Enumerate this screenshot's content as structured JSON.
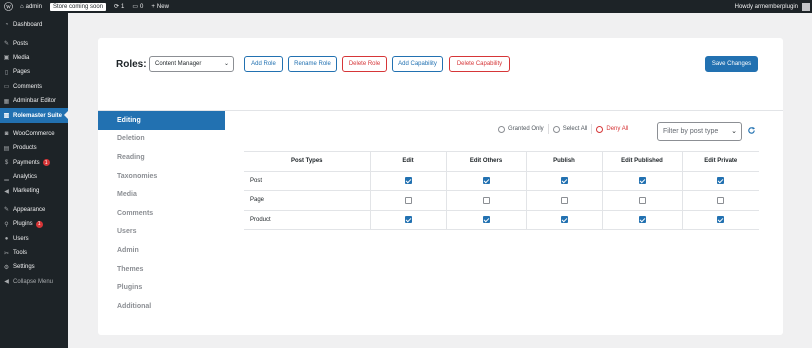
{
  "adminbar": {
    "site_name": "admin",
    "coming_soon": "Store coming soon",
    "updates_count": "1",
    "comments_count": "0",
    "new_label": "New",
    "howdy": "Howdy armemberplugin"
  },
  "sidebar": {
    "items": [
      {
        "label": "Dashboard",
        "icon": "dashboard-icon"
      },
      {
        "label": "Posts",
        "icon": "pin-icon"
      },
      {
        "label": "Media",
        "icon": "media-icon"
      },
      {
        "label": "Pages",
        "icon": "page-icon"
      },
      {
        "label": "Comments",
        "icon": "comment-icon"
      },
      {
        "label": "Adminbar Editor",
        "icon": "grid-icon"
      },
      {
        "label": "Rolemaster Suite",
        "icon": "building-icon"
      },
      {
        "label": "WooCommerce",
        "icon": "woo-icon"
      },
      {
        "label": "Products",
        "icon": "box-icon"
      },
      {
        "label": "Payments",
        "icon": "card-icon",
        "badge": "1"
      },
      {
        "label": "Analytics",
        "icon": "chart-icon"
      },
      {
        "label": "Marketing",
        "icon": "megaphone-icon"
      },
      {
        "label": "Appearance",
        "icon": "brush-icon"
      },
      {
        "label": "Plugins",
        "icon": "plug-icon",
        "badge": "1"
      },
      {
        "label": "Users",
        "icon": "user-icon"
      },
      {
        "label": "Tools",
        "icon": "wrench-icon"
      },
      {
        "label": "Settings",
        "icon": "settings-icon"
      },
      {
        "label": "Collapse Menu",
        "icon": "collapse-icon"
      }
    ]
  },
  "header": {
    "roles_label": "Roles:",
    "selected_role": "Content Manager",
    "add_role": "Add Role",
    "rename_role": "Rename Role",
    "delete_role": "Delete Role",
    "add_capability": "Add Capability",
    "delete_capability": "Delete Capability",
    "save_changes": "Save Changes"
  },
  "tabs": [
    "Editing",
    "Deletion",
    "Reading",
    "Taxonomies",
    "Media",
    "Comments",
    "Users",
    "Admin",
    "Themes",
    "Plugins",
    "Additional"
  ],
  "filters": {
    "granted_only": "Granted Only",
    "select_all": "Select All",
    "deny_all": "Deny All",
    "post_type_placeholder": "Filter by post type"
  },
  "table": {
    "columns": [
      "Post Types",
      "Edit",
      "Edit Others",
      "Publish",
      "Edit Published",
      "Edit Private"
    ],
    "rows": [
      {
        "type": "Post",
        "checks": [
          true,
          true,
          true,
          true,
          true
        ]
      },
      {
        "type": "Page",
        "checks": [
          false,
          false,
          false,
          false,
          false
        ]
      },
      {
        "type": "Product",
        "checks": [
          true,
          true,
          true,
          true,
          true
        ]
      }
    ]
  },
  "colors": {
    "accent": "#2271b1",
    "danger": "#d63638",
    "sidebar_bg": "#1d2327"
  }
}
